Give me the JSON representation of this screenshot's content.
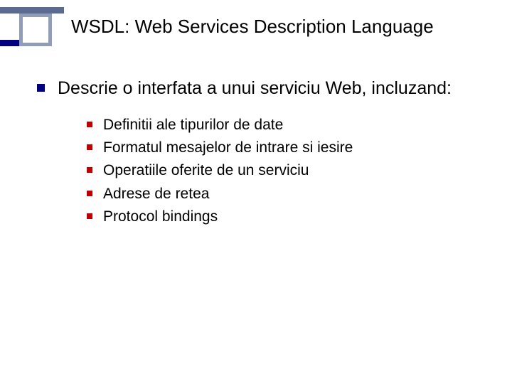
{
  "title": "WSDL: Web Services Description Language",
  "main_point": "Descrie o interfata a unui serviciu Web, incluzand:",
  "sub_points": {
    "0": "Definitii ale tipurilor de date",
    "1": "Formatul mesajelor de intrare si iesire",
    "2": "Operatiile oferite de un serviciu",
    "3": "Adrese de retea",
    "4": "Protocol bindings"
  }
}
